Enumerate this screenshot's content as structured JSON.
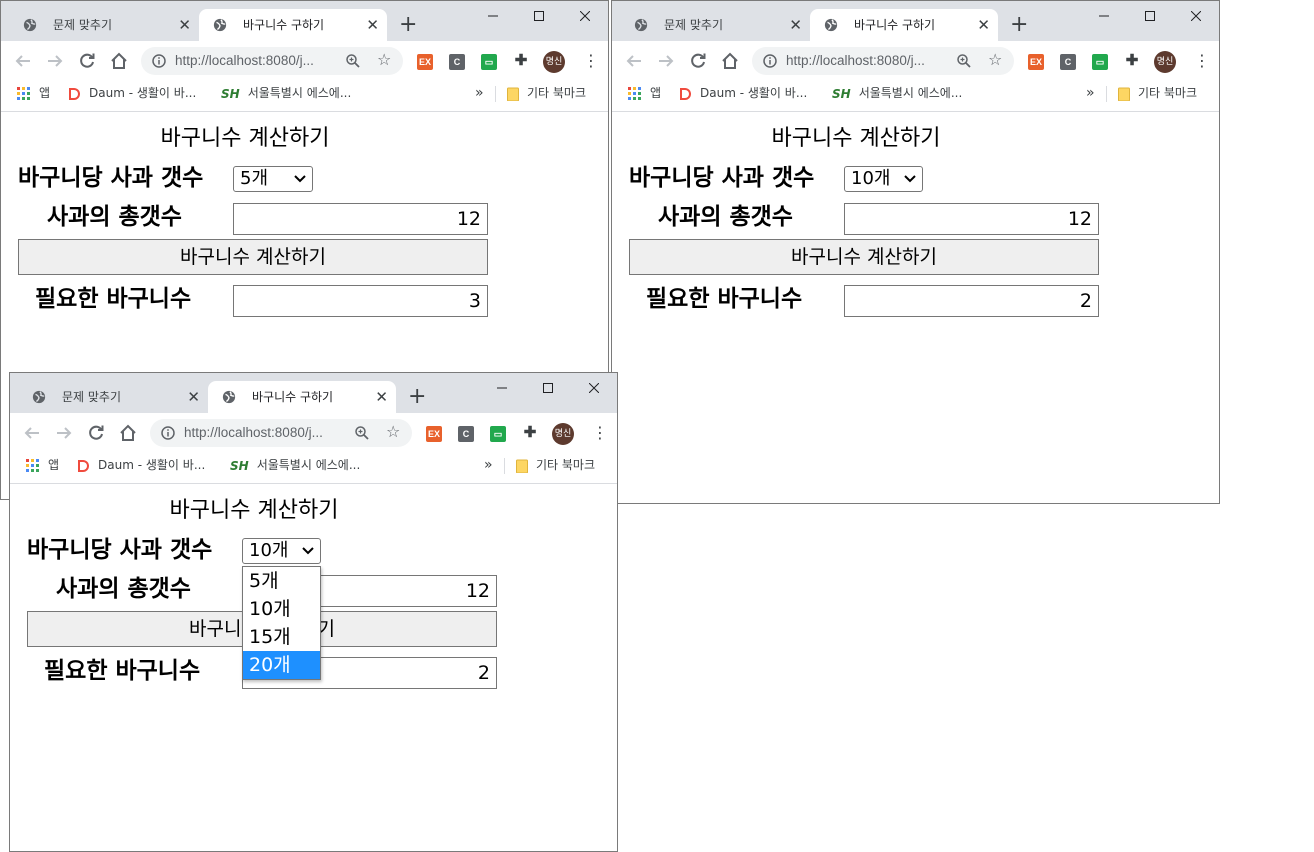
{
  "windows": [
    {
      "tabs": {
        "inactive": "문제 맞추기",
        "active": "바구니수 구하기"
      },
      "address": "http://localhost:8080/j...",
      "avatar": "명신",
      "bookmarks": {
        "apps": "앱",
        "daum": "Daum - 생활이 바...",
        "seoul": "서울특별시 에스에...",
        "other": "기타 북마크"
      },
      "page": {
        "title": "바구니수 계산하기",
        "per_basket_label": "바구니당 사과 갯수",
        "per_basket_value": "5개",
        "total_label": "사과의 총갯수",
        "total_value": "12",
        "calc_button": "바구니수 계산하기",
        "result_label": "필요한 바구니수",
        "result_value": "3"
      }
    },
    {
      "tabs": {
        "inactive": "문제 맞추기",
        "active": "바구니수 구하기"
      },
      "address": "http://localhost:8080/j...",
      "avatar": "명신",
      "bookmarks": {
        "apps": "앱",
        "daum": "Daum - 생활이 바...",
        "seoul": "서울특별시 에스에...",
        "other": "기타 북마크"
      },
      "page": {
        "title": "바구니수 계산하기",
        "per_basket_label": "바구니당 사과 갯수",
        "per_basket_value": "10개",
        "total_label": "사과의 총갯수",
        "total_value": "12",
        "calc_button": "바구니수 계산하기",
        "result_label": "필요한 바구니수",
        "result_value": "2"
      }
    },
    {
      "tabs": {
        "inactive": "문제 맞추기",
        "active": "바구니수 구하기"
      },
      "address": "http://localhost:8080/j...",
      "avatar": "명신",
      "bookmarks": {
        "apps": "앱",
        "daum": "Daum - 생활이 바...",
        "seoul": "서울특별시 에스에...",
        "other": "기타 북마크"
      },
      "page": {
        "title": "바구니수 계산하기",
        "per_basket_label": "바구니당 사과 갯수",
        "per_basket_value": "10개",
        "total_label": "사과의 총갯수",
        "total_value": "12",
        "calc_button": "바구니수 계산하기",
        "result_label": "필요한 바구니수",
        "result_value": "2",
        "dropdown_options": [
          "5개",
          "10개",
          "15개",
          "20개"
        ],
        "dropdown_highlighted": "20개"
      }
    }
  ],
  "colors": {
    "tabstrip": "#dee1e6",
    "highlight": "#1e90ff",
    "button_bg": "#efefef"
  }
}
